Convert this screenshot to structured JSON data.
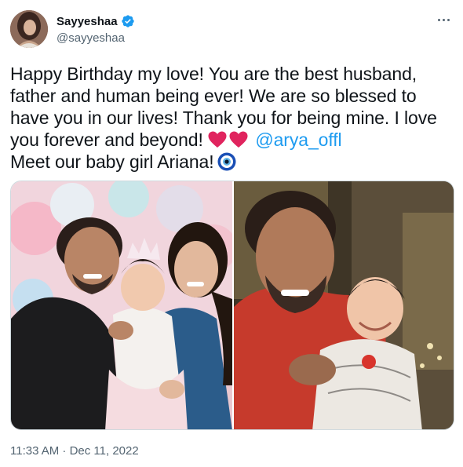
{
  "author": {
    "display_name": "Sayyeshaa",
    "handle": "@sayyeshaa",
    "verified": true
  },
  "tweet": {
    "line1": "Happy Birthday my love! You are the best husband,",
    "line2": "father and human being ever! We are so blessed to",
    "line3": "have you in our lives! Thank you for being mine. I love",
    "line4_text": "you forever and beyond!",
    "line4_mention": "@arya_offl",
    "line5": "Meet our baby girl Ariana!"
  },
  "icons": {
    "verified": "verified-badge-icon",
    "more": "more-horizontal-icon",
    "heart": "red-heart-emoji",
    "nazar": "nazar-amulet-emoji"
  },
  "colors": {
    "link": "#1d9bf0",
    "heart": "#e0245e",
    "secondary_text": "#536471"
  },
  "timestamp": "11:33 AM · Dec 11, 2022"
}
